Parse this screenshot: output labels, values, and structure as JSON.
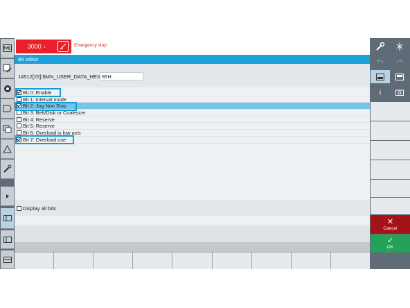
{
  "status": {
    "alarm_number": "3000",
    "alarm_arrow": "↓",
    "alarm_text": "Emergency stop"
  },
  "dialog": {
    "title": "Bit editor",
    "param_label": "14512[25]:$MN_USER_DATA_HEX =",
    "param_value": "85H",
    "bits": [
      {
        "label": "Bit 0: Enable",
        "checked": true
      },
      {
        "label": "Bit 1: Interval mode",
        "checked": false
      },
      {
        "label": "Bit 2: Jog Non Stop",
        "checked": true
      },
      {
        "label": "Bit 3: Belt/Disk or Coalescer",
        "checked": false
      },
      {
        "label": "Bit 4: Reserve",
        "checked": false
      },
      {
        "label": "Bit 5: Reserve",
        "checked": false
      },
      {
        "label": "Bit 6: Overload is low axis",
        "checked": false
      },
      {
        "label": "Bit 7: Overload use",
        "checked": true
      }
    ],
    "selected_index": 2,
    "display_all_label": "Display all bits",
    "display_all_checked": false
  },
  "right_bar": {
    "info_label": "i",
    "cancel_label": "Cancel",
    "ok_label": "OK"
  },
  "colors": {
    "accent": "#1ba0d7",
    "alarm": "#e8202a",
    "cancel": "#a41318",
    "ok": "#26a15a"
  },
  "icons": [
    "machine-icon",
    "edit-icon",
    "offset-icon",
    "program-icon",
    "program-manager-icon",
    "diagnostics-icon",
    "setup-icon",
    "expand-icon",
    "wrench-icon",
    "tool-icon",
    "undo-icon",
    "redo-icon",
    "window-icon",
    "keyboard-icon",
    "info-icon",
    "camera-icon",
    "close-icon",
    "check-icon"
  ]
}
